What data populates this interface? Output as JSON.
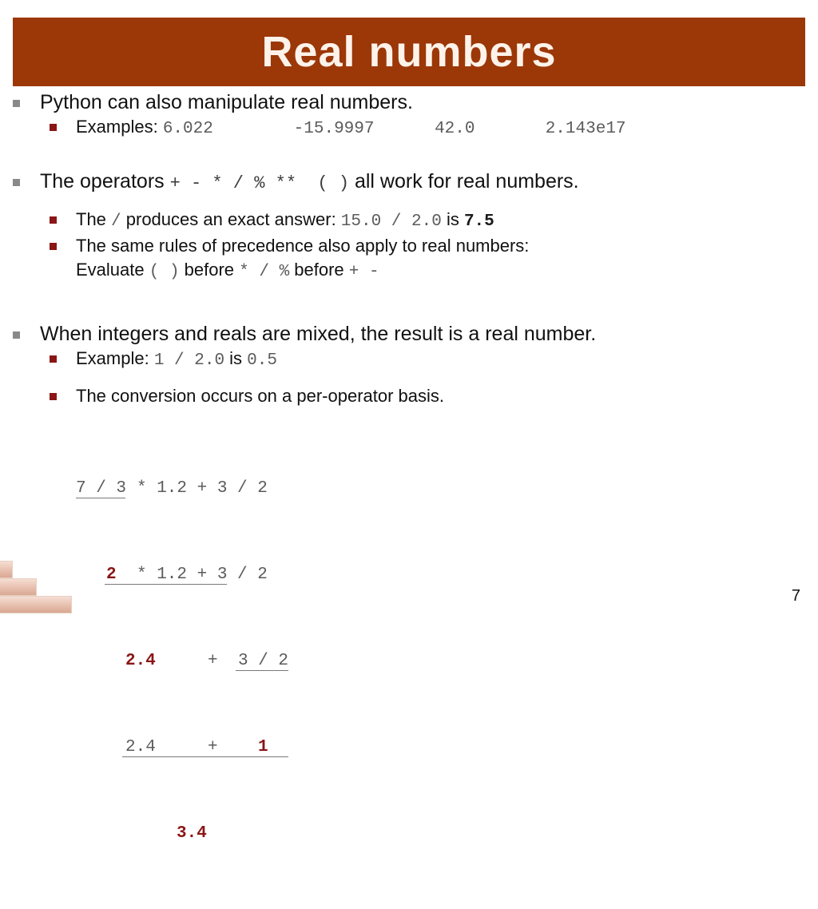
{
  "slide": {
    "title": "Real numbers",
    "page_number": "7",
    "banner_color": "#9c3708",
    "level1_bullet_color": "#898989",
    "level2_bullet_color": "#8a1616",
    "accent_red": "#8a1616",
    "code_color": "#5b5b5b"
  },
  "bullets": {
    "b1": {
      "text": "Python can also manipulate real numbers.",
      "sub1_label": "Examples: ",
      "sub1_examples": "6.022        -15.9997      42.0       2.143e17"
    },
    "b2": {
      "prefix": "The operators ",
      "operators": "+ - * / % **  ( )",
      "suffix": " all work for real numbers.",
      "sub1_prefix": "The ",
      "sub1_op": "/",
      "sub1_mid": " produces an exact answer: ",
      "sub1_expr": "15.0 / 2.0",
      "sub1_is": " is ",
      "sub1_value": "7.5",
      "sub2_line1": "The same rules of precedence also apply to real numbers:",
      "sub2_line2_prefix": "Evaluate ",
      "sub2_line2_paren": "( )",
      "sub2_line2_before1": " before ",
      "sub2_line2_ops": "* / %",
      "sub2_line2_before2": " before ",
      "sub2_line2_ops2": "+ -"
    },
    "b3": {
      "text": "When integers and reals are mixed, the result is a real number.",
      "sub1_label": "Example: ",
      "sub1_expr": "1 / 2.0",
      "sub1_is": " is ",
      "sub1_value": "0.5",
      "sub2_text": "The conversion occurs on a per-operator basis."
    }
  },
  "calculation": {
    "line1": {
      "underlined": "7 / 3",
      "rest": "* 1.2 + 3 / 2"
    },
    "line2": {
      "result": "2",
      "rest": "* 1.2 + 3 / 2"
    },
    "line3": {
      "result": "2.4",
      "plus": "+",
      "underlined": "3 / 2"
    },
    "line4": {
      "left": "2.4",
      "plus": "+",
      "result": "1"
    },
    "line5": {
      "result": "3.4"
    }
  }
}
